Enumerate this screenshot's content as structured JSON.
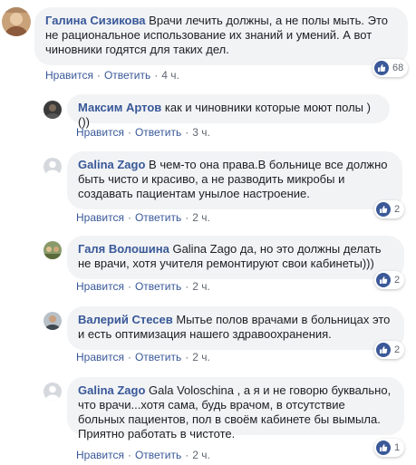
{
  "actions": {
    "like": "Нравится",
    "reply": "Ответить",
    "separator": "·"
  },
  "colors": {
    "link": "#385898",
    "bubble": "#f2f3f5",
    "meta": "#606770",
    "like_badge": "#3b5998"
  },
  "comments": [
    {
      "author": "Галина Сизикова",
      "text": "Врачи лечить должны, а не полы мыть. Это не рациональное использование их знаний и умений. А вот чиновники годятся для таких дел.",
      "time": "4 ч.",
      "reactions": "68",
      "reaction_icon": "like-icon"
    },
    {
      "author": "Максим Артов",
      "text": "как и чиновники которые моют полы )())",
      "time": "3 ч."
    },
    {
      "author": "Galina Zago",
      "text": "В чем-то она права.В больнице все должно быть чисто и красиво, а не разводить микробы и создавать пациентам унылое настроение.",
      "time": "2 ч.",
      "reactions": "2",
      "reaction_icon": "like-icon"
    },
    {
      "author": "Галя Волошина",
      "text": "Galina Zago да, но это должны делать не врачи, хотя учителя ремонтируют свои кабинеты)))",
      "time": "2 ч.",
      "reactions": "2",
      "reaction_icon": "like-icon"
    },
    {
      "author": "Валерий Стесев",
      "text": "Мытье полов врачами в больницах это и есть оптимизация нашего здравоохранения.",
      "time": "2 ч.",
      "reactions": "2",
      "reaction_icon": "like-icon"
    },
    {
      "author": "Galina Zago",
      "text": "Gala Voloschina , а я и не говорю буквально, что врачи...хотя сама, будь врачом, в отсутствие больных пациентов, пол в своём кабинете бы вымыла. Приятно работать в чистоте.",
      "time": "2 ч.",
      "reactions": "1",
      "reaction_icon": "like-icon"
    }
  ]
}
